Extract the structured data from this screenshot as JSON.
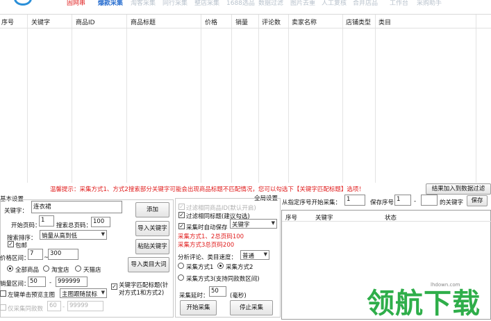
{
  "nav": {
    "items": [
      "固网串",
      "爆款采集",
      "淘客采集",
      "同行采集",
      "整店采集",
      "1688选品",
      "数据过滤",
      "图片去重",
      "人工复核",
      "合并店品",
      "工作台",
      "采购助手"
    ],
    "active_index": 1
  },
  "table": {
    "headers": [
      "序号",
      "关键字",
      "商品ID",
      "商品标题",
      "价格",
      "销量",
      "评论数",
      "卖家名称",
      "店铺类型",
      "类目"
    ]
  },
  "tip": "温馨提示：采集方式1、方式2搜索部分关键字可能会出现商品标题不匹配情况，您可以勾选下【关键字匹配标题】选项！",
  "export_button": "结果加入到数据过滤",
  "basic": {
    "title": "基本设置",
    "keyword_label": "关键字：",
    "keyword_value": "连衣裙",
    "start_page_label": "开始页码：",
    "start_page_value": "1",
    "total_pages_label": "搜索总页码：",
    "total_pages_value": "100",
    "sort_label": "搜索排序：",
    "sort_value": "销量从高到低",
    "freeship_label": "包邮",
    "freeship_checked": true,
    "price_label": "价格区间：",
    "price_min": "7",
    "price_max": "300",
    "price_sep": "~",
    "radio_all": "全部商品",
    "radio_taobao": "淘宝店",
    "radio_tmall": "天猫店",
    "selected_shop": "all",
    "sales_label": "销量区间：",
    "sales_min": "50",
    "sales_max": "999999",
    "sales_sep": "-",
    "leftclick_label": "左键单击预览主图",
    "leftclick_checked": false,
    "follow_value": "主图跟随鼠标",
    "same_label": "仅采集同款数",
    "same_checked": false,
    "same_min": "60",
    "same_max": "99999",
    "same_sep": "-",
    "add_btn": "添加",
    "import_btn": "导入关键字",
    "paste_btn": "粘贴关键字",
    "import_cat_btn": "导入类目大词",
    "match_title_label": "关键字匹配标题(针对方式1和方式2)",
    "match_title_checked": true
  },
  "global": {
    "title": "全局设置",
    "filter_id_label": "过滤相同商品ID(默认开启)",
    "filter_id_checked": true,
    "filter_title_label": "过滤相同标题(建议勾选)",
    "filter_title_checked": true,
    "auto_save_label": "采集时自动保存",
    "auto_save_checked": true,
    "save_field_value": "关键字",
    "note1": "采集方式1、2总页码100",
    "note2": "采集方式3总页码200",
    "speed_label": "分析评论、类目速度：",
    "speed_value": "普通",
    "method1": "采集方式1",
    "method2": "采集方式2",
    "method3": "采集方式3(支持同款数区间)",
    "selected_method": "2",
    "delay_label": "采集延时：",
    "delay_value": "50",
    "delay_unit": "(毫秒)",
    "start_btn": "开始采集",
    "stop_btn": "停止采集"
  },
  "right": {
    "from_label": "从指定序号开始采集：",
    "from_value": "1",
    "save_seq_label": "保存序号：",
    "save_from": "1",
    "save_to": "",
    "save_sep": "-",
    "kw_suffix": "的关键字",
    "save_btn": "保存",
    "headers": [
      "序号",
      "关键字",
      "状态"
    ]
  },
  "watermark": {
    "text": "领航下载",
    "url": "lhdown.com"
  }
}
